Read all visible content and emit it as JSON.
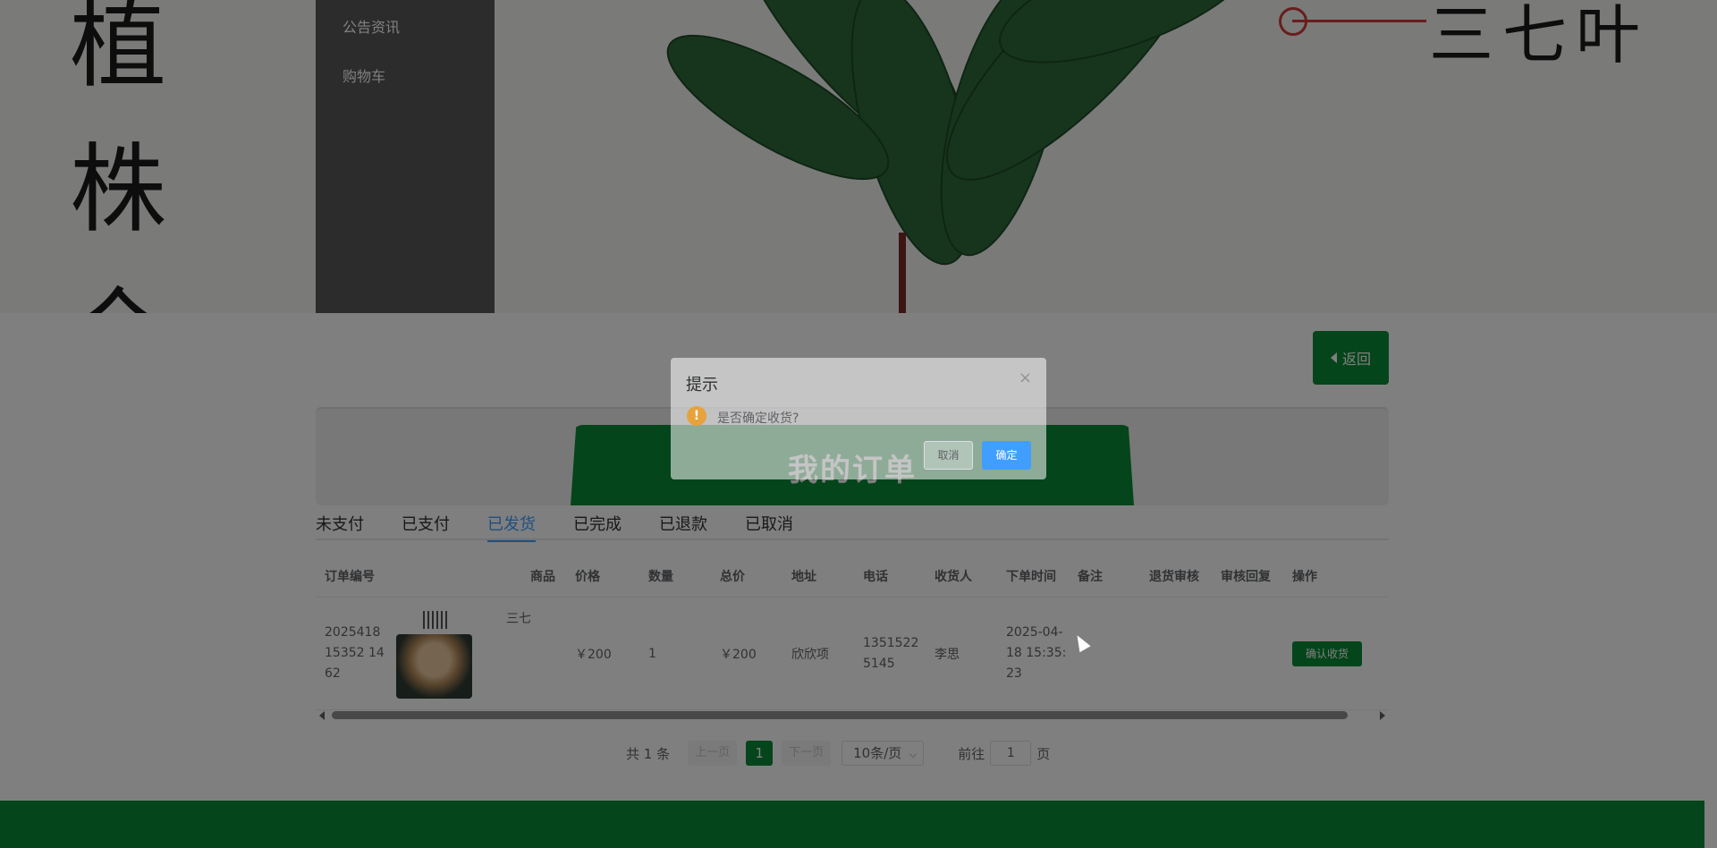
{
  "banner": {
    "left_chars": [
      "植",
      "株",
      "全"
    ],
    "leaf_label": "三七叶"
  },
  "side_menu": {
    "items": [
      {
        "label": "公告资讯"
      },
      {
        "label": "购物车"
      }
    ]
  },
  "back_button": {
    "label": "返回",
    "icon": "caret-left-icon"
  },
  "page_title": "我的订单",
  "tabs": [
    {
      "label": "未支付"
    },
    {
      "label": "已支付"
    },
    {
      "label": "已发货",
      "active": true
    },
    {
      "label": "已完成"
    },
    {
      "label": "已退款"
    },
    {
      "label": "已取消"
    }
  ],
  "table": {
    "headers": [
      "订单编号",
      "商品",
      "价格",
      "数量",
      "总价",
      "地址",
      "电话",
      "收货人",
      "下单时间",
      "备注",
      "退货审核",
      "审核回复",
      "操作"
    ],
    "rows": [
      {
        "order_id": "202541815352 1462",
        "goods_name": "三七",
        "price": "￥200",
        "qty": "1",
        "total": "￥200",
        "address": "欣欣项",
        "phone": "13515225145",
        "receiver": "李思",
        "order_time": "2025-04-18 15:35:23",
        "note": "",
        "refund_review": "",
        "review_reply": "",
        "action": "确认收货"
      }
    ]
  },
  "pagination": {
    "total": "共 1 条",
    "prev": "上一页",
    "current_page": "1",
    "next": "下一页",
    "page_size": "10条/页",
    "goto_label": "前往",
    "goto_value": "1",
    "page_unit": "页"
  },
  "dialog": {
    "title": "提示",
    "close": "×",
    "icon": "warning-icon",
    "message": "是否确定收货?",
    "cancel": "取消",
    "confirm": "确定"
  },
  "colors": {
    "brand_green": "#0a8a36",
    "primary_blue": "#409eff",
    "warning_orange": "#e6a23c",
    "side_menu_bg": "#595959"
  }
}
